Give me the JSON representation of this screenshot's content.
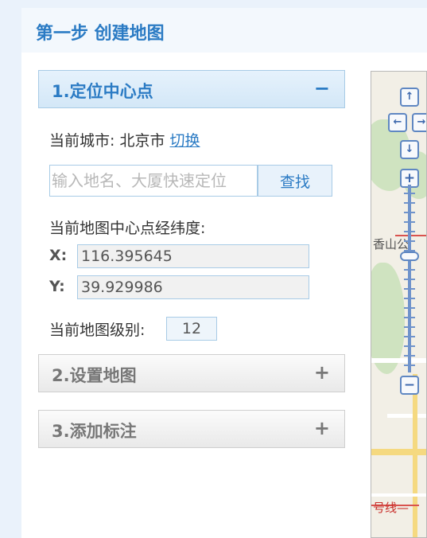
{
  "header": {
    "title": "第一步 创建地图"
  },
  "sections": [
    {
      "title": "1.定位中心点",
      "toggle": "−"
    },
    {
      "title": "2.设置地图",
      "toggle": "+"
    },
    {
      "title": "3.添加标注",
      "toggle": "+"
    }
  ],
  "locate": {
    "city_label": "当前城市:",
    "city": "北京市",
    "switch_link": "切换",
    "search_placeholder": "输入地名、大厦快速定位",
    "search_button": "查找",
    "center_label": "当前地图中心点经纬度:",
    "x_label": "X:",
    "x_value": "116.395645",
    "y_label": "Y:",
    "y_value": "39.929986",
    "level_label": "当前地图级别:",
    "level_value": "12"
  },
  "map": {
    "nav": {
      "up": "↑",
      "left": "←",
      "right": "→",
      "down": "↓"
    },
    "zoom_in": "+",
    "zoom_out": "−",
    "labels": {
      "place": "香山公",
      "metro": "号线—"
    },
    "colors": {
      "park": "#cfe3c0",
      "road": "#f5d980",
      "metro": "#d9534f"
    }
  }
}
